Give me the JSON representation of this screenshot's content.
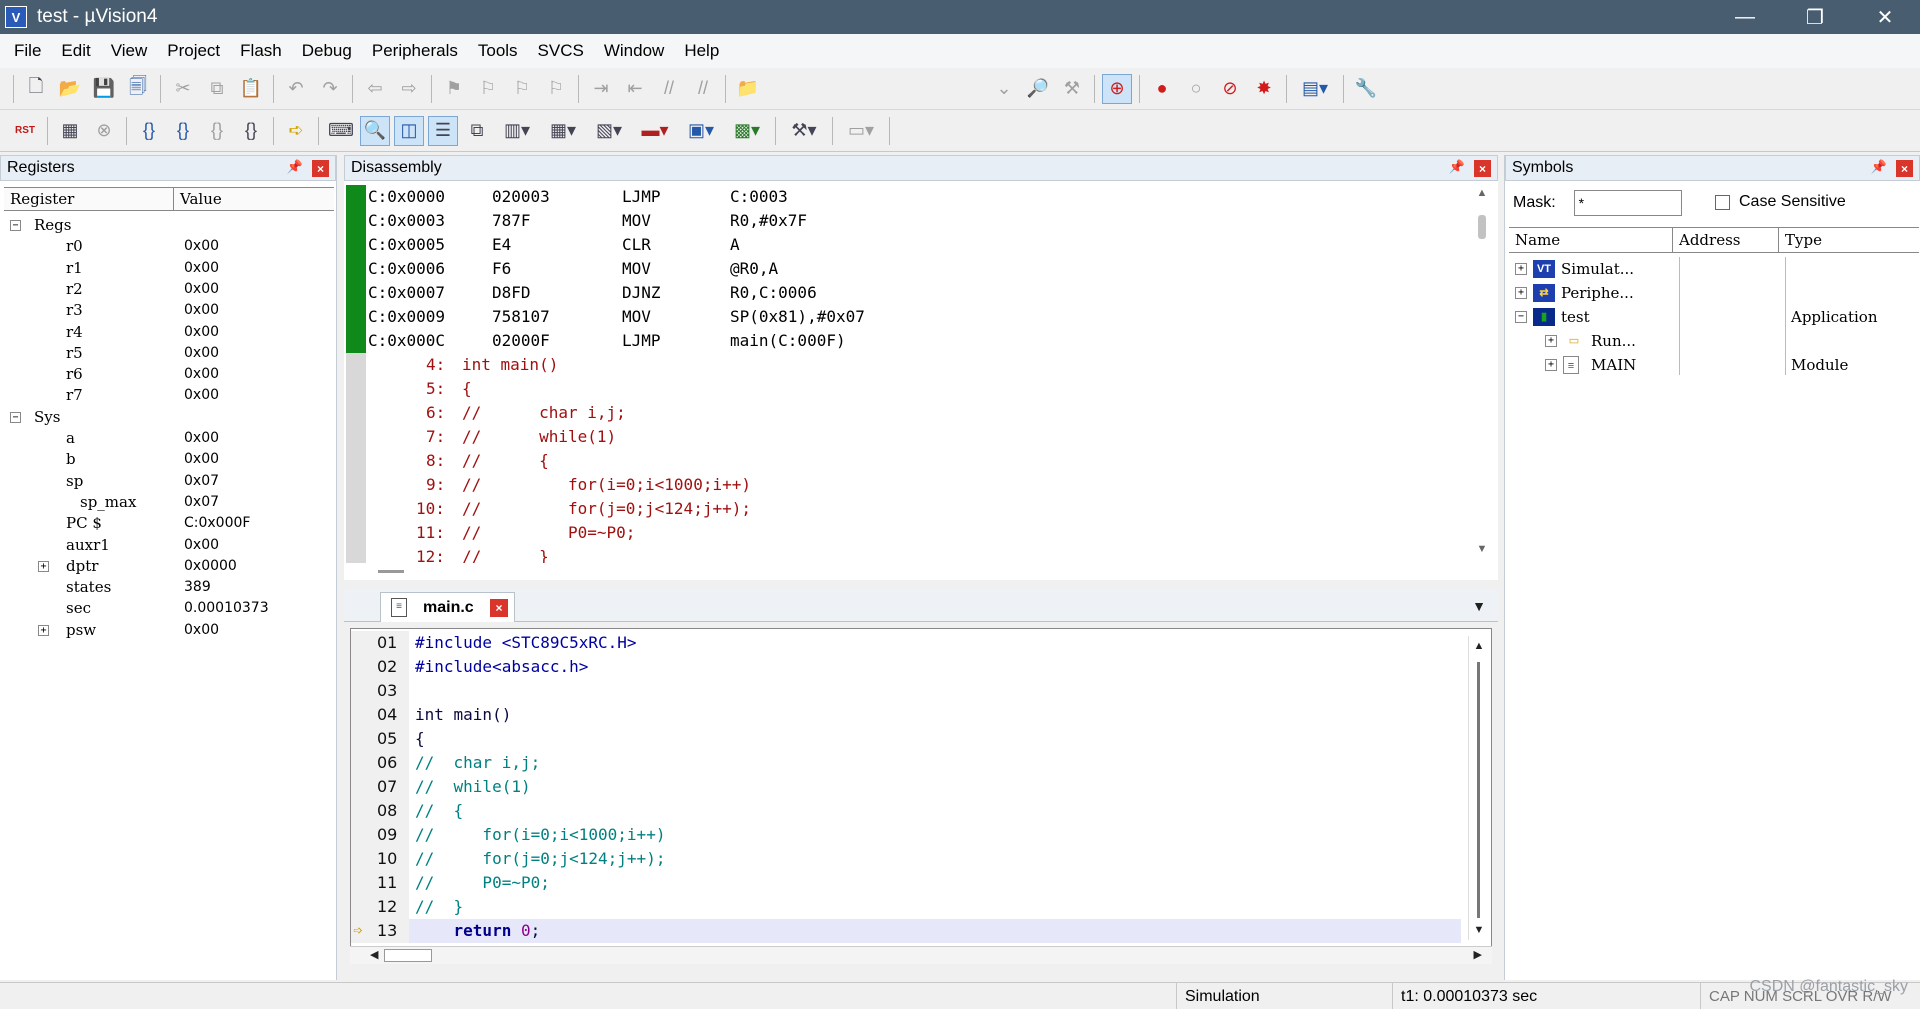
{
  "window": {
    "title": "test  - µVision4",
    "icon_label": "V",
    "controls": [
      "—",
      "❐",
      "✕"
    ]
  },
  "menu": [
    "File",
    "Edit",
    "View",
    "Project",
    "Flash",
    "Debug",
    "Peripherals",
    "Tools",
    "SVCS",
    "Window",
    "Help"
  ],
  "toolbar2": {
    "rst_label": "RST"
  },
  "registers": {
    "title": "Registers",
    "columns": [
      "Register",
      "Value"
    ],
    "rows": [
      {
        "name": "Regs",
        "value": "",
        "indent": 0,
        "expander": "−"
      },
      {
        "name": "r0",
        "value": "0x00",
        "indent": 2,
        "expander": ""
      },
      {
        "name": "r1",
        "value": "0x00",
        "indent": 2,
        "expander": ""
      },
      {
        "name": "r2",
        "value": "0x00",
        "indent": 2,
        "expander": ""
      },
      {
        "name": "r3",
        "value": "0x00",
        "indent": 2,
        "expander": ""
      },
      {
        "name": "r4",
        "value": "0x00",
        "indent": 2,
        "expander": ""
      },
      {
        "name": "r5",
        "value": "0x00",
        "indent": 2,
        "expander": ""
      },
      {
        "name": "r6",
        "value": "0x00",
        "indent": 2,
        "expander": ""
      },
      {
        "name": "r7",
        "value": "0x00",
        "indent": 2,
        "expander": ""
      },
      {
        "name": "Sys",
        "value": "",
        "indent": 0,
        "expander": "−"
      },
      {
        "name": "a",
        "value": "0x00",
        "indent": 2,
        "expander": ""
      },
      {
        "name": "b",
        "value": "0x00",
        "indent": 2,
        "expander": ""
      },
      {
        "name": "sp",
        "value": "0x07",
        "indent": 2,
        "expander": ""
      },
      {
        "name": "sp_max",
        "value": "0x07",
        "indent": 3,
        "expander": ""
      },
      {
        "name": "PC  $",
        "value": "C:0x000F",
        "indent": 2,
        "expander": ""
      },
      {
        "name": "auxr1",
        "value": "0x00",
        "indent": 2,
        "expander": ""
      },
      {
        "name": "dptr",
        "value": "0x0000",
        "indent": 2,
        "expander": "+"
      },
      {
        "name": "states",
        "value": "389",
        "indent": 2,
        "expander": ""
      },
      {
        "name": "sec",
        "value": "0.00010373",
        "indent": 2,
        "expander": ""
      },
      {
        "name": "psw",
        "value": "0x00",
        "indent": 2,
        "expander": "+"
      }
    ]
  },
  "disassembly": {
    "title": "Disassembly",
    "instructions": [
      {
        "addr": "C:0x0000",
        "bytes": "020003",
        "mnemonic": "LJMP",
        "operand": "C:0003"
      },
      {
        "addr": "C:0x0003",
        "bytes": "787F",
        "mnemonic": "MOV",
        "operand": "R0,#0x7F"
      },
      {
        "addr": "C:0x0005",
        "bytes": "E4",
        "mnemonic": "CLR",
        "operand": "A"
      },
      {
        "addr": "C:0x0006",
        "bytes": "F6",
        "mnemonic": "MOV",
        "operand": "@R0,A"
      },
      {
        "addr": "C:0x0007",
        "bytes": "D8FD",
        "mnemonic": "DJNZ",
        "operand": "R0,C:0006"
      },
      {
        "addr": "C:0x0009",
        "bytes": "758107",
        "mnemonic": "MOV",
        "operand": "SP(0x81),#0x07"
      },
      {
        "addr": "C:0x000C",
        "bytes": "02000F",
        "mnemonic": "LJMP",
        "operand": "main(C:000F)"
      }
    ],
    "source_lines": [
      {
        "num": "4:",
        "text": "int main()"
      },
      {
        "num": "5:",
        "text": "{"
      },
      {
        "num": "6:",
        "text": "//      char i,j;"
      },
      {
        "num": "7:",
        "text": "//      while(1)"
      },
      {
        "num": "8:",
        "text": "//      {"
      },
      {
        "num": "9:",
        "text": "//         for(i=0;i<1000;i++)"
      },
      {
        "num": "10:",
        "text": "//         for(j=0;j<124;j++);"
      },
      {
        "num": "11:",
        "text": "//         P0=~P0;"
      },
      {
        "num": "12:",
        "text": "//      }"
      }
    ]
  },
  "editor": {
    "tab_label": "main.c",
    "lines": [
      {
        "num": "01",
        "parts": [
          [
            "k-pre",
            "#include "
          ],
          [
            "k-str",
            "<STC89C5xRC.H>"
          ]
        ]
      },
      {
        "num": "02",
        "parts": [
          [
            "k-pre",
            "#include"
          ],
          [
            "k-str",
            "<absacc.h>"
          ]
        ]
      },
      {
        "num": "03",
        "parts": []
      },
      {
        "num": "04",
        "parts": [
          [
            "k-plain",
            "int main()"
          ]
        ]
      },
      {
        "num": "05",
        "parts": [
          [
            "k-plain",
            "{"
          ]
        ]
      },
      {
        "num": "06",
        "parts": [
          [
            "k-cmt",
            "//  char i,j;"
          ]
        ]
      },
      {
        "num": "07",
        "parts": [
          [
            "k-cmt",
            "//  while(1)"
          ]
        ]
      },
      {
        "num": "08",
        "parts": [
          [
            "k-cmt",
            "//  {"
          ]
        ]
      },
      {
        "num": "09",
        "parts": [
          [
            "k-cmt",
            "//     for(i=0;i<1000;i++)"
          ]
        ]
      },
      {
        "num": "10",
        "parts": [
          [
            "k-cmt",
            "//     for(j=0;j<124;j++);"
          ]
        ]
      },
      {
        "num": "11",
        "parts": [
          [
            "k-cmt",
            "//     P0=~P0;"
          ]
        ]
      },
      {
        "num": "12",
        "parts": [
          [
            "k-cmt",
            "//  }"
          ]
        ]
      },
      {
        "num": "13",
        "parts": [
          [
            "k-plain",
            "    "
          ],
          [
            "k-kw",
            "return"
          ],
          [
            "k-plain",
            " "
          ],
          [
            "k-num",
            "0"
          ],
          [
            "k-plain",
            ";"
          ]
        ],
        "current": true
      }
    ]
  },
  "symbols": {
    "title": "Symbols",
    "mask_label": "Mask:",
    "mask_value": "*",
    "case_label": "Case Sensitive",
    "columns": [
      "Name",
      "Address",
      "Type"
    ],
    "rows": [
      {
        "name": "Simulat...",
        "type": "",
        "indent": 0,
        "expander": "+",
        "icon": "VT"
      },
      {
        "name": "Periphe...",
        "type": "",
        "indent": 0,
        "expander": "+",
        "icon": "PER"
      },
      {
        "name": "test",
        "type": "Application",
        "indent": 0,
        "expander": "−",
        "icon": "APP"
      },
      {
        "name": "Run...",
        "type": "",
        "indent": 1,
        "expander": "+",
        "icon": "FOLDER"
      },
      {
        "name": "MAIN",
        "type": "Module",
        "indent": 1,
        "expander": "+",
        "icon": "FILE"
      }
    ]
  },
  "status": {
    "mode": "Simulation",
    "time": "t1: 0.00010373 sec",
    "indicators": "CAP NUM SCRL OVR R/W",
    "watermark": "CSDN @fantastic_sky"
  },
  "colors": {
    "titlebar": "#485e70",
    "exec_marker": "#0f8a1a",
    "close_red": "#d9352a",
    "comment_teal": "#008080",
    "disasm_source_red": "#a01010"
  }
}
